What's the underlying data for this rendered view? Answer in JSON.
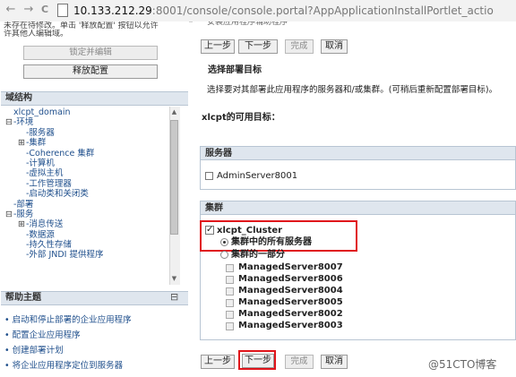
{
  "browser": {
    "url_host": "10.133.212.29",
    "url_rest": ":8001/console/console.portal?AppApplicationInstallPortlet_actio",
    "back": "←",
    "forward": "→",
    "reload": "C"
  },
  "change_center": {
    "note_line1": "未存在待修改。单击 '释放配置' 按钮以允许",
    "note_line2": "许其他人编辑域。",
    "lock_button": "锁定并编辑",
    "release_button": "释放配置"
  },
  "domain_structure": {
    "header": "域结构",
    "rows": [
      {
        "exp": "",
        "label": "xlcpt_domain",
        "indent": 0
      },
      {
        "exp": "⊟",
        "label": "-环境",
        "indent": 0
      },
      {
        "exp": "",
        "label": "-服务器",
        "indent": 1
      },
      {
        "exp": "⊞",
        "label": "-集群",
        "indent": 1
      },
      {
        "exp": "",
        "label": "-Coherence 集群",
        "indent": 1
      },
      {
        "exp": "",
        "label": "-计算机",
        "indent": 1
      },
      {
        "exp": "",
        "label": "-虚拟主机",
        "indent": 1
      },
      {
        "exp": "",
        "label": "-工作管理器",
        "indent": 1
      },
      {
        "exp": "",
        "label": "-启动类和关闭类",
        "indent": 1
      },
      {
        "exp": "",
        "label": "-部署",
        "indent": 0
      },
      {
        "exp": "⊟",
        "label": "-服务",
        "indent": 0
      },
      {
        "exp": "⊞",
        "label": "-消息传送",
        "indent": 1
      },
      {
        "exp": "",
        "label": "-数据源",
        "indent": 1
      },
      {
        "exp": "",
        "label": "-持久性存储",
        "indent": 1
      },
      {
        "exp": "",
        "label": "-外部 JNDI 提供程序",
        "indent": 1
      }
    ]
  },
  "help": {
    "header": "帮助主题",
    "collapse": "⊟",
    "items": [
      "启动和停止部署的企业应用程序",
      "配置企业应用程序",
      "创建部署计划",
      "将企业应用程序定位到服务器"
    ]
  },
  "wizard": {
    "top_cut_title": "安装应用程序辅助程序",
    "back": "上一步",
    "next": "下一步",
    "finish": "完成",
    "cancel": "取消",
    "title": "选择部署目标",
    "description": "选择要对其部署此应用程序的服务器和/或集群。(可稍后重新配置部署目标)。",
    "targets_title": "xlcpt的可用目标：",
    "servers_header": "服务器",
    "admin_server": "AdminServer8001",
    "clusters_header": "集群",
    "cluster_name": "xlcpt_Cluster",
    "option_all": "集群中的所有服务器",
    "option_part": "集群的一部分",
    "managed_servers": [
      "ManagedServer8007",
      "ManagedServer8006",
      "ManagedServer8004",
      "ManagedServer8005",
      "ManagedServer8002",
      "ManagedServer8003"
    ]
  },
  "watermark": "@51CTO博客",
  "colors": {
    "highlight": "#e0151b",
    "panel_header": "#dfe6ee",
    "link": "#1f4f8c"
  }
}
